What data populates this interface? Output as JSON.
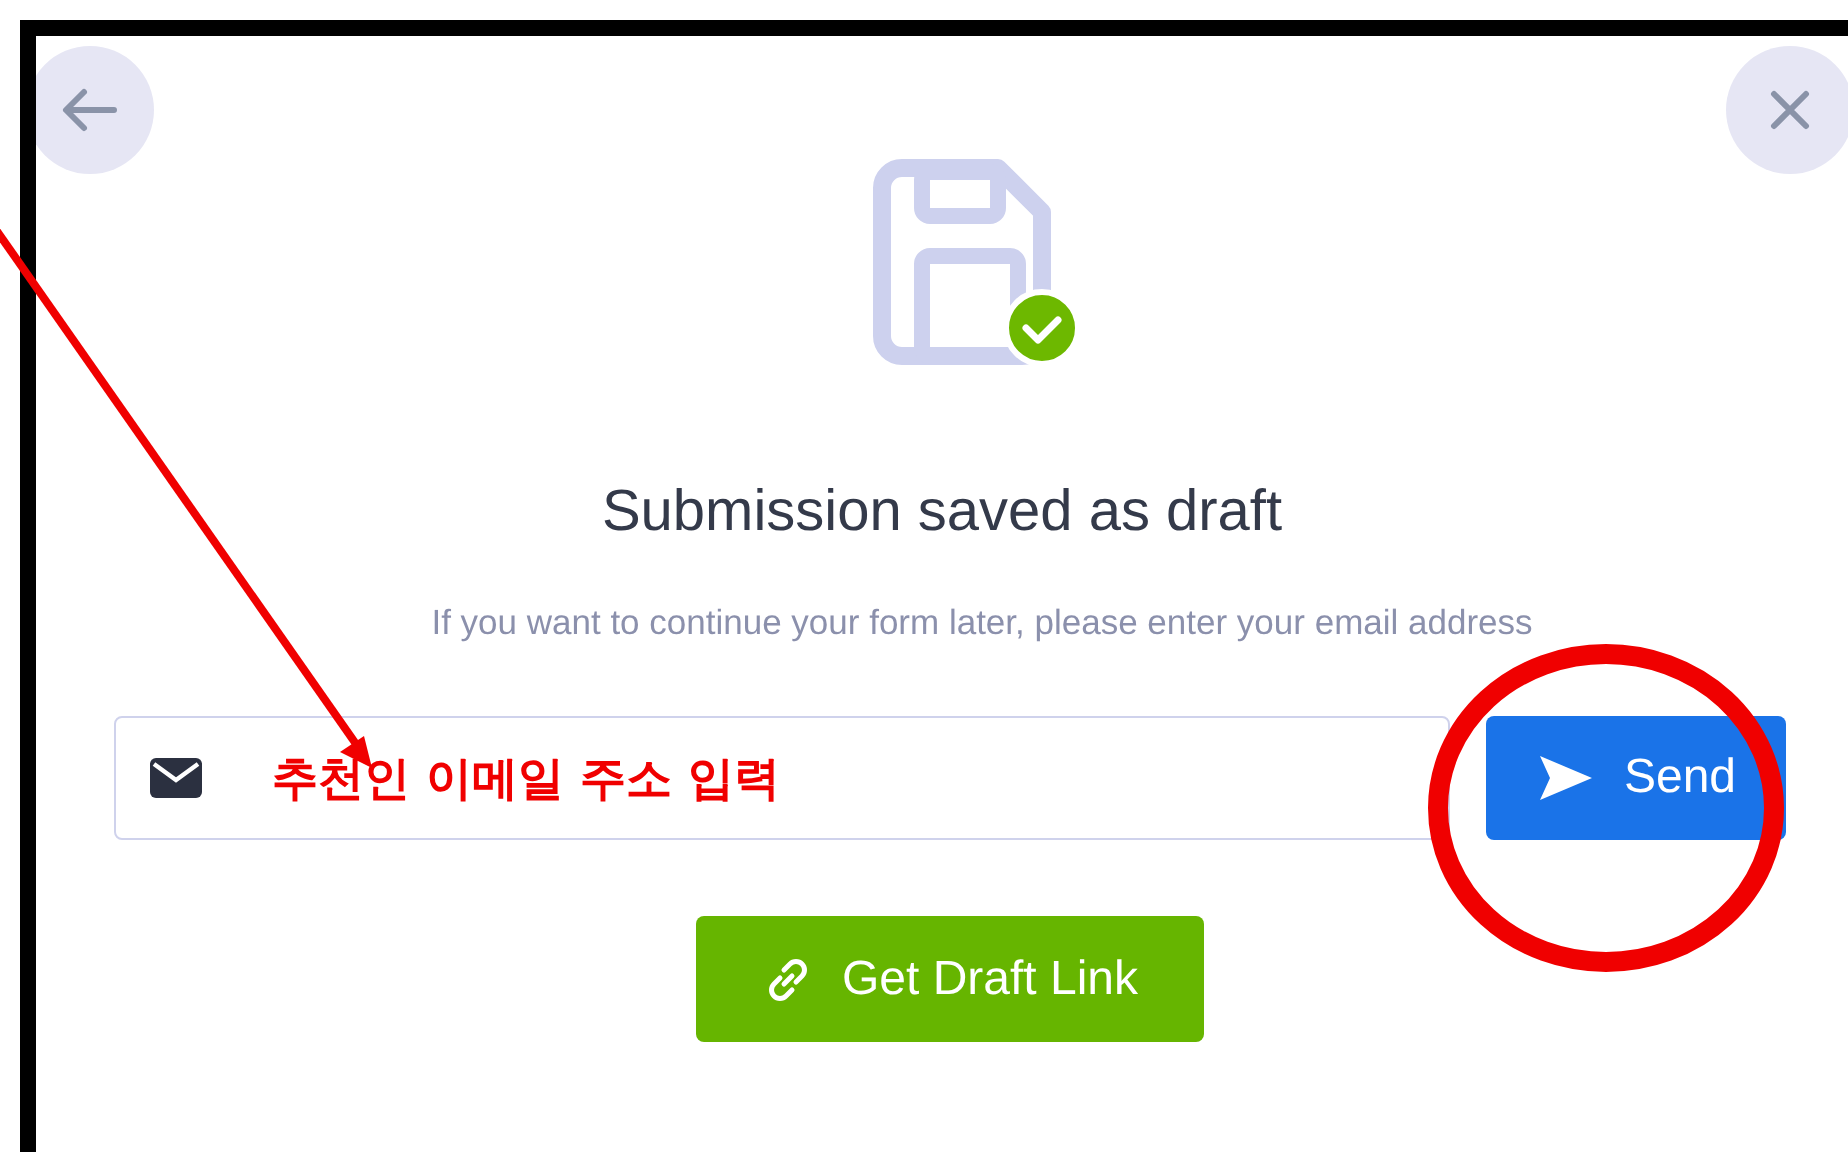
{
  "title": "Submission saved as draft",
  "message": "If you want to continue your form later, please enter your email address",
  "email_field": {
    "annotation": "추천인 이메일 주소 입력"
  },
  "send_button": {
    "label": "Send"
  },
  "draft_link_button": {
    "label": "Get Draft Link"
  }
}
